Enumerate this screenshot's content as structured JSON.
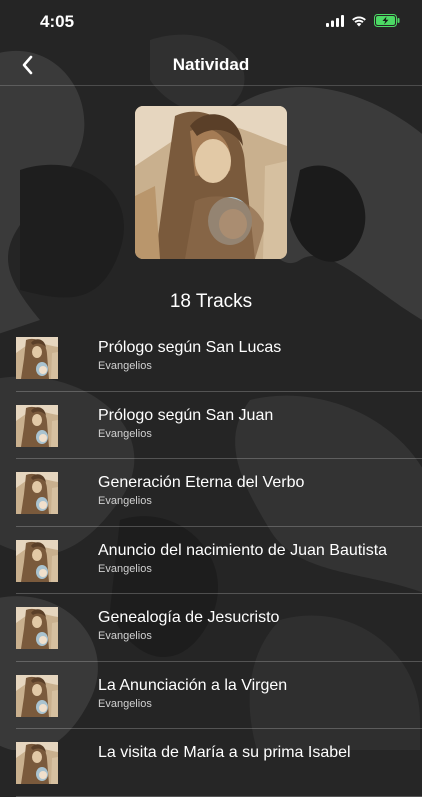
{
  "status_bar": {
    "time": "4:05"
  },
  "nav": {
    "title": "Natividad"
  },
  "album": {
    "track_count_label": "18 Tracks"
  },
  "tracks": [
    {
      "title": "Prólogo según San Lucas",
      "subtitle": "Evangelios"
    },
    {
      "title": "Prólogo según San Juan",
      "subtitle": "Evangelios"
    },
    {
      "title": "Generación Eterna del Verbo",
      "subtitle": "Evangelios"
    },
    {
      "title": "Anuncio del nacimiento de Juan Bautista",
      "subtitle": "Evangelios"
    },
    {
      "title": "Genealogía de Jesucristo",
      "subtitle": "Evangelios"
    },
    {
      "title": "La Anunciación a la Virgen",
      "subtitle": "Evangelios"
    },
    {
      "title": "La visita de María a su prima Isabel",
      "subtitle": ""
    }
  ],
  "colors": {
    "background": "#262626",
    "text": "#ffffff",
    "battery": "#4cd964"
  },
  "icons": [
    "signal-icon",
    "wifi-icon",
    "battery-charging-icon",
    "back-chevron-icon"
  ]
}
